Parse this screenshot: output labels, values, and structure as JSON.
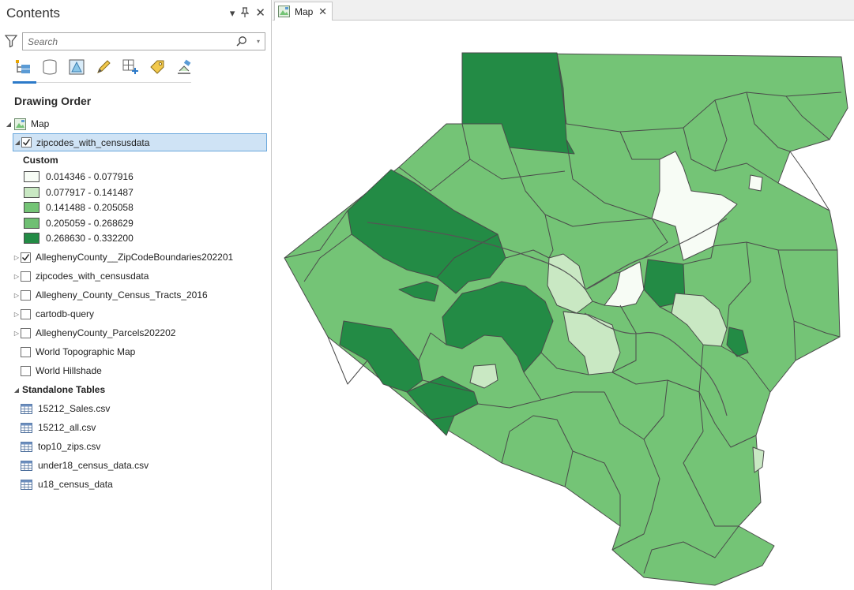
{
  "contents": {
    "title": "Contents",
    "controls": {
      "menu": "▾",
      "pin": "📌",
      "close": "✕"
    },
    "search": {
      "placeholder": "Search"
    },
    "toolbar_icons": [
      "list-by-drawing-order-icon",
      "list-by-source-icon",
      "list-by-selection-icon",
      "list-by-editing-icon",
      "list-by-snapping-icon",
      "list-by-labeling-icon",
      "list-by-perspective-imagery-icon"
    ],
    "section_title": "Drawing Order",
    "map_item": "Map",
    "selected_layer": {
      "label": "zipcodes_with_censusdata",
      "checked": true
    },
    "legend": {
      "title": "Custom",
      "classes": [
        {
          "label": "0.014346 - 0.077916",
          "color": "#f7fcf5"
        },
        {
          "label": "0.077917 - 0.141487",
          "color": "#c9e8c3"
        },
        {
          "label": "0.141488 - 0.205058",
          "color": "#74c476"
        },
        {
          "label": "0.205059 - 0.268629",
          "color": "#6fbf73"
        },
        {
          "label": "0.268630 - 0.332200",
          "color": "#238b45"
        }
      ]
    },
    "layers": [
      {
        "label": "AlleghenyCounty__ZipCodeBoundaries202201",
        "checked": true,
        "expandable": true
      },
      {
        "label": "zipcodes_with_censusdata",
        "checked": false,
        "expandable": true
      },
      {
        "label": "Allegheny_County_Census_Tracts_2016",
        "checked": false,
        "expandable": true
      },
      {
        "label": "cartodb-query",
        "checked": false,
        "expandable": true
      },
      {
        "label": "AlleghenyCounty_Parcels202202",
        "checked": false,
        "expandable": true
      },
      {
        "label": "World Topographic Map",
        "checked": false,
        "expandable": false
      },
      {
        "label": "World Hillshade",
        "checked": false,
        "expandable": false
      }
    ],
    "standalone_title": "Standalone Tables",
    "tables": [
      "15212_Sales.csv",
      "15212_all.csv",
      "top10_zips.csv",
      "under18_census_data.csv",
      "u18_census_data"
    ]
  },
  "map_tab": {
    "label": "Map",
    "close": "✕"
  },
  "map_colors": {
    "border": "#4a4a4a",
    "fill_main": "#74c476",
    "fill_dark": "#238b45",
    "fill_light": "#c9e8c3",
    "fill_lightest": "#f7fcf5"
  }
}
